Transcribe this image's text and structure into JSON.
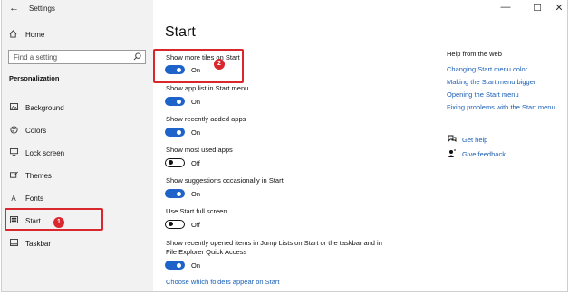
{
  "window": {
    "title": "Settings",
    "back_glyph": "←",
    "controls": [
      "—",
      "☐",
      "✕"
    ]
  },
  "sidebar": {
    "home_label": "Home",
    "search_placeholder": "Find a setting",
    "section_title": "Personalization",
    "items": [
      {
        "label": "Background",
        "icon": "picture-icon"
      },
      {
        "label": "Colors",
        "icon": "palette-icon"
      },
      {
        "label": "Lock screen",
        "icon": "monitor-icon"
      },
      {
        "label": "Themes",
        "icon": "brush-icon"
      },
      {
        "label": "Fonts",
        "icon": "font-icon"
      },
      {
        "label": "Start",
        "icon": "start-icon"
      },
      {
        "label": "Taskbar",
        "icon": "taskbar-icon"
      }
    ],
    "callout_number": "1"
  },
  "main": {
    "title": "Start",
    "options": [
      {
        "label": "Show more tiles on Start",
        "state": "On",
        "on": true
      },
      {
        "label": "Show app list in Start menu",
        "state": "On",
        "on": true
      },
      {
        "label": "Show recently added apps",
        "state": "On",
        "on": true
      },
      {
        "label": "Show most used apps",
        "state": "Off",
        "on": false
      },
      {
        "label": "Show suggestions occasionally in Start",
        "state": "On",
        "on": true
      },
      {
        "label": "Use Start full screen",
        "state": "Off",
        "on": false
      },
      {
        "label": "Show recently opened items in Jump Lists on Start or the taskbar and in File Explorer Quick Access",
        "state": "On",
        "on": true
      }
    ],
    "folders_link": "Choose which folders appear on Start",
    "callout_number": "2"
  },
  "help": {
    "title": "Help from the web",
    "links": [
      "Changing Start menu color",
      "Making the Start menu bigger",
      "Opening the Start menu",
      "Fixing problems with the Start menu"
    ],
    "get_help": "Get help",
    "give_feedback": "Give feedback"
  },
  "colors": {
    "accent": "#1e63c9",
    "link": "#1a5fb4",
    "callout": "#d9272e",
    "sidebar_bg": "#f2f2f2"
  }
}
